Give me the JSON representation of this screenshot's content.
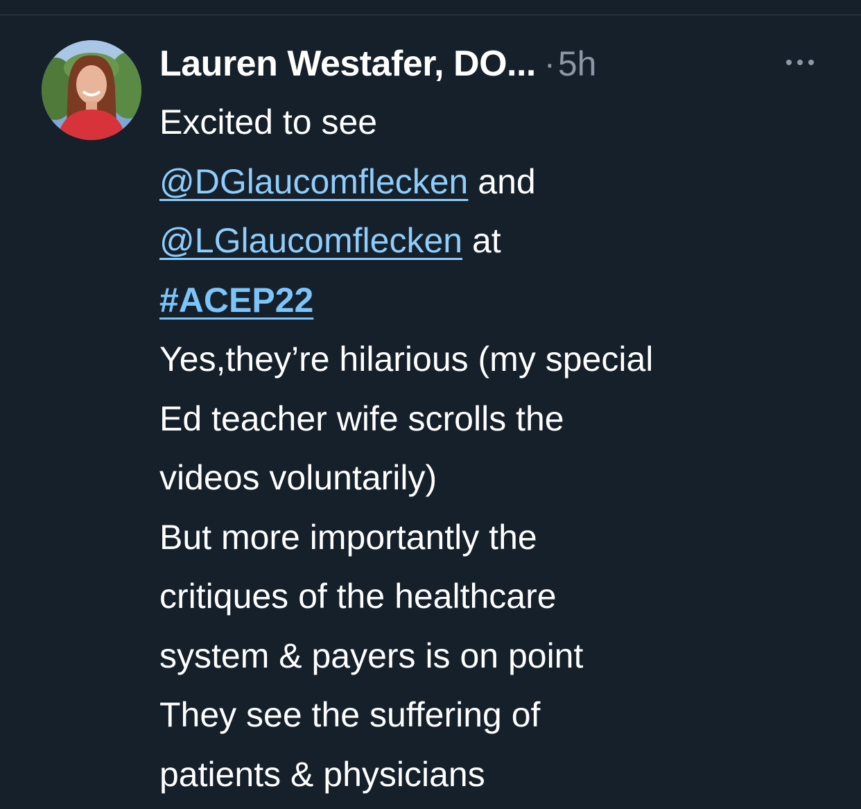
{
  "tweet": {
    "author_name": "Lauren Westafer, DO...",
    "separator": "·",
    "timestamp": "5h",
    "more_icon": "more-horizontal-icon",
    "lines": {
      "l1": "Excited to see",
      "l2_mention": "@DGlaucomflecken",
      "l2_rest": " and",
      "l3_mention": "@LGlaucomflecken",
      "l3_rest": " at",
      "l4_hashtag": "#ACEP22",
      "l5": "Yes,they’re hilarious (my special",
      "l6": "Ed teacher wife scrolls the",
      "l7": "videos voluntarily)",
      "l8": "But more importantly the",
      "l9": "critiques of the healthcare",
      "l10": "system & payers is on point",
      "l11": "They see the suffering of",
      "l12": "patients & physicians"
    }
  },
  "colors": {
    "background": "#15202b",
    "text": "#ffffff",
    "muted": "#8b98a5",
    "link": "#8fcdfb"
  }
}
